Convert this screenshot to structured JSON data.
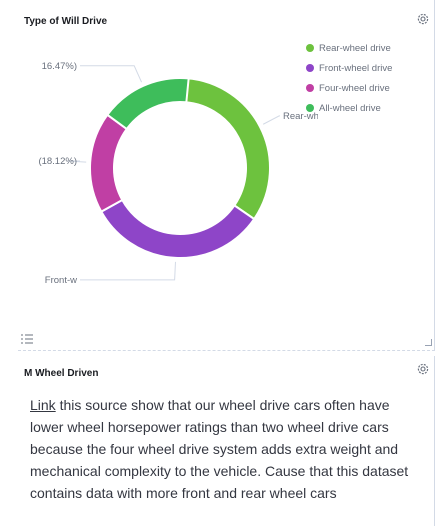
{
  "chart_panel": {
    "title": "Type of Will Drive",
    "settings_icon": "gear-icon",
    "legend_icon": "list-icon"
  },
  "chart_data": {
    "type": "pie",
    "title": "Type of Will Drive",
    "donut": true,
    "legend_position": "top-right",
    "series": [
      {
        "name": "Rear-wheel drive",
        "color": "#6dc23e",
        "share": 0.3459,
        "label": "Rear-wh"
      },
      {
        "name": "Front-wheel drive",
        "color": "#8e45c8",
        "share": 0.3235,
        "label": "Front-w"
      },
      {
        "name": "Four-wheel drive",
        "color": "#c03fa4",
        "share": 0.1812,
        "label": "(18.12%)"
      },
      {
        "name": "All-wheel drive",
        "color": "#3ebd5b",
        "share": 0.1647,
        "label": "16.47%)"
      }
    ]
  },
  "text_panel": {
    "title": "M Wheel Driven",
    "settings_icon": "gear-icon",
    "link_text": "Link",
    "body": " this source show that our wheel drive cars often have lower wheel horsepower ratings than two wheel drive cars because the four wheel drive system adds extra weight and mechanical complexity to the vehicle. Cause that this dataset contains data with more front and rear wheel cars"
  }
}
